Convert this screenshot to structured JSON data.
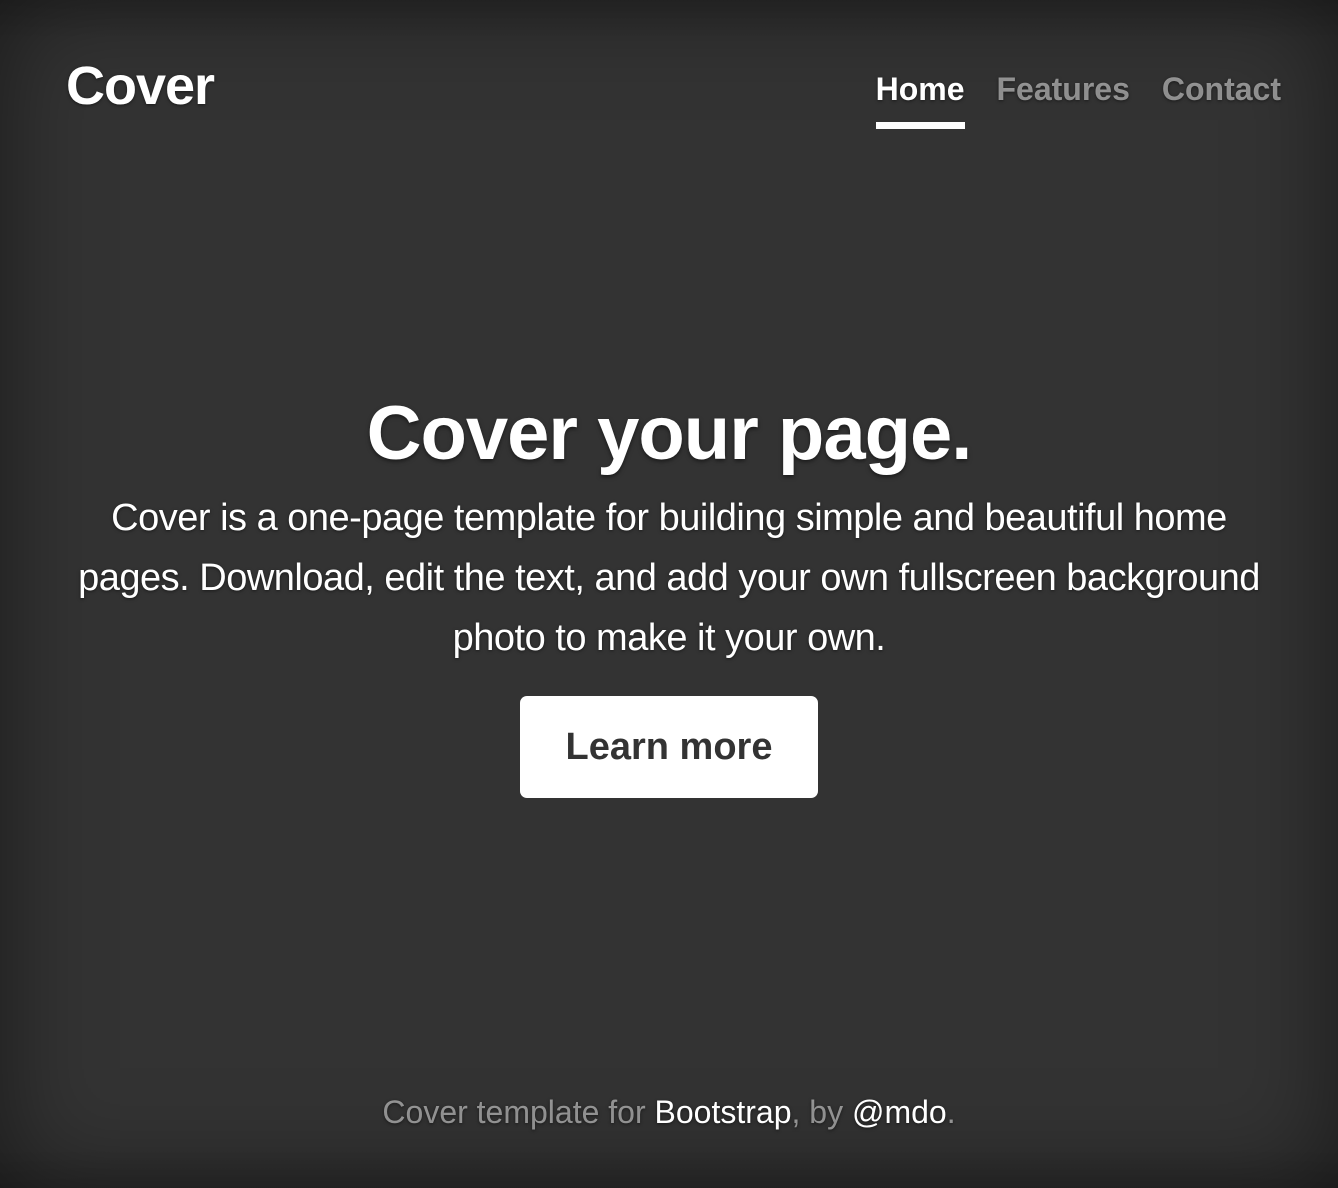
{
  "header": {
    "brand": "Cover",
    "nav": [
      {
        "label": "Home",
        "active": true
      },
      {
        "label": "Features",
        "active": false
      },
      {
        "label": "Contact",
        "active": false
      }
    ]
  },
  "main": {
    "heading": "Cover your page.",
    "lead": "Cover is a one-page template for building simple and beautiful home pages. Download, edit the text, and add your own fullscreen background photo to make it your own.",
    "button_label": "Learn more"
  },
  "footer": {
    "prefix": "Cover template for ",
    "link1": "Bootstrap",
    "middle": ", by ",
    "link2": "@mdo",
    "suffix": "."
  },
  "colors": {
    "background": "#333333",
    "text": "#ffffff",
    "muted": "rgba(255,255,255,0.5)"
  }
}
